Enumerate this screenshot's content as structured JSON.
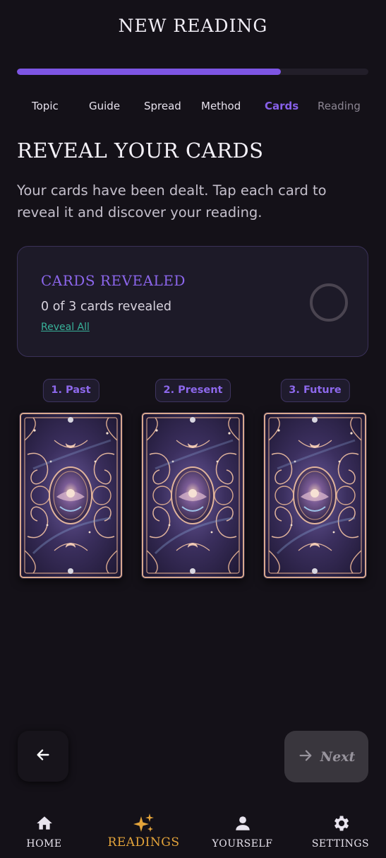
{
  "header": {
    "title": "NEW READING"
  },
  "progress": {
    "value": 0.75
  },
  "steps": [
    {
      "label": "Topic",
      "state": "done"
    },
    {
      "label": "Guide",
      "state": "done"
    },
    {
      "label": "Spread",
      "state": "done"
    },
    {
      "label": "Method",
      "state": "done"
    },
    {
      "label": "Cards",
      "state": "active"
    },
    {
      "label": "Reading",
      "state": "upcoming"
    }
  ],
  "main": {
    "title": "REVEAL YOUR CARDS",
    "intro": "Your cards have been dealt. Tap each card to reveal it and discover your reading."
  },
  "status": {
    "heading": "CARDS REVEALED",
    "count": "0 of 3 cards revealed",
    "reveal_all": "Reveal All",
    "revealed": 0,
    "total": 3
  },
  "cards": [
    {
      "label": "1. Past"
    },
    {
      "label": "2. Present"
    },
    {
      "label": "3. Future"
    }
  ],
  "footer": {
    "back_icon": "arrow-left-icon",
    "next_label": "Next",
    "next_icon": "arrow-right-icon"
  },
  "nav": [
    {
      "label": "HOME",
      "icon": "home-icon",
      "active": false
    },
    {
      "label": "READINGS",
      "icon": "sparkles-icon",
      "active": true
    },
    {
      "label": "YOURSELF",
      "icon": "person-icon",
      "active": false
    },
    {
      "label": "SETTINGS",
      "icon": "gear-icon",
      "active": false
    }
  ],
  "colors": {
    "accent": "#7d55e3",
    "active_nav": "#e4a43a",
    "link": "#38b29a",
    "background": "#141118"
  }
}
